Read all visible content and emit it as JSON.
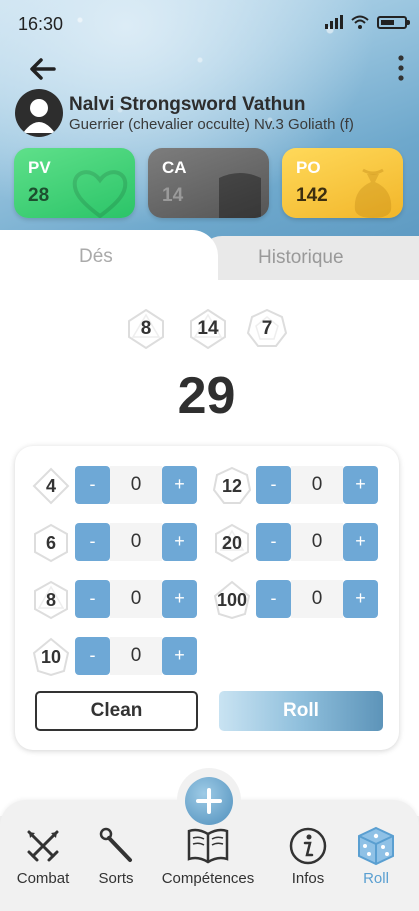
{
  "status_bar": {
    "time": "16:30"
  },
  "character": {
    "name": "Nalvi Strongsword Vathun",
    "description": "Guerrier (chevalier occulte) Nv.3 Goliath (f)"
  },
  "stats": {
    "pv": {
      "label": "PV",
      "value": "28"
    },
    "ca": {
      "label": "CA",
      "value": "14"
    },
    "po": {
      "label": "PO",
      "value": "142"
    }
  },
  "tabs": {
    "dice": "Dés",
    "history": "Historique"
  },
  "results": {
    "dice": [
      "8",
      "14",
      "7"
    ],
    "total": "29"
  },
  "dice_panel": {
    "rows": [
      {
        "die": "4",
        "count": "0"
      },
      {
        "die": "6",
        "count": "0"
      },
      {
        "die": "8",
        "count": "0"
      },
      {
        "die": "10",
        "count": "0"
      },
      {
        "die": "12",
        "count": "0"
      },
      {
        "die": "20",
        "count": "0"
      },
      {
        "die": "100",
        "count": "0"
      }
    ],
    "minus": "-",
    "plus": "+",
    "clean_label": "Clean",
    "roll_label": "Roll"
  },
  "nav": {
    "items": [
      {
        "label": "Combat",
        "icon": "crossed-swords-icon"
      },
      {
        "label": "Sorts",
        "icon": "wand-icon"
      },
      {
        "label": "Compétences",
        "icon": "book-icon"
      },
      {
        "label": "Infos",
        "icon": "info-icon"
      },
      {
        "label": "Roll",
        "icon": "dice-icon",
        "active": true
      }
    ]
  },
  "colors": {
    "pv_card": "#2bc468",
    "ca_card": "#555555",
    "po_card": "#f2b62a",
    "stepper_button": "#6ea8d6",
    "active_nav": "#5a9fd1"
  }
}
